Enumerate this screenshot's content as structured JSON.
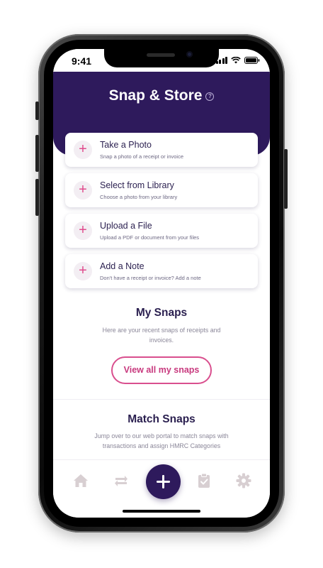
{
  "status_bar": {
    "time": "9:41"
  },
  "header": {
    "title": "Snap & Store",
    "help_symbol": "?"
  },
  "actions": [
    {
      "title": "Take a Photo",
      "subtitle": "Snap a photo of a receipt or invoice",
      "icon": "plus-icon"
    },
    {
      "title": "Select from Library",
      "subtitle": "Choose a photo from your library",
      "icon": "plus-icon"
    },
    {
      "title": "Upload a File",
      "subtitle": "Upload a PDF or document from your files",
      "icon": "plus-icon"
    },
    {
      "title": "Add a Note",
      "subtitle": "Don't have a receipt or invoice? Add a note",
      "icon": "plus-icon"
    }
  ],
  "my_snaps": {
    "title": "My Snaps",
    "description": "Here are your recent snaps of receipts and invoices.",
    "button_label": "View all my snaps"
  },
  "match_snaps": {
    "title": "Match Snaps",
    "description": "Jump over to our web portal to match snaps with transactions and assign HMRC Categories"
  },
  "bottom_nav": {
    "items": [
      "home-icon",
      "transfer-arrows-icon",
      "add-icon",
      "clipboard-check-icon",
      "settings-gear-icon"
    ]
  },
  "colors": {
    "primary": "#2e1a5c",
    "accent": "#d94f8e",
    "nav_icon": "#d8cfd2"
  }
}
